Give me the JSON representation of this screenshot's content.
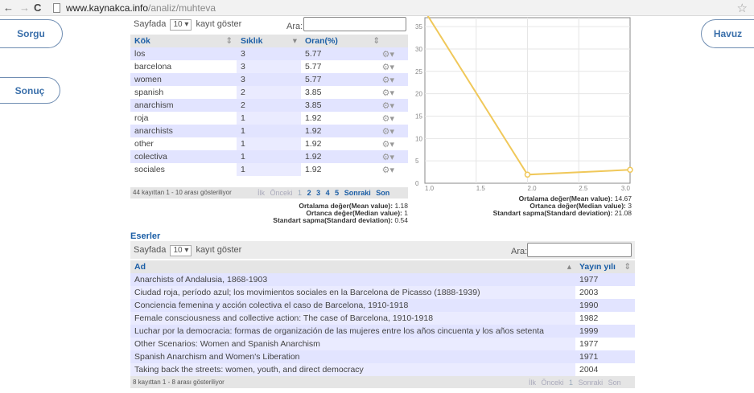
{
  "browser": {
    "back": "←",
    "forward": "→",
    "reload": "C",
    "url_host": "www.kaynakca.info",
    "url_path": "/analiz/muhteva",
    "star": "☆"
  },
  "side_tabs": {
    "sorgu": "Sorgu",
    "sonuc": "Sonuç",
    "havuz": "Havuz"
  },
  "top_table": {
    "length_prefix": "Sayfada",
    "length_value": "10",
    "length_suffix": "kayıt göster",
    "search_label": "Ara:",
    "headers": [
      "Kök",
      "Sıklık",
      "Oran(%)"
    ],
    "rows": [
      [
        "los",
        "3",
        "5.77"
      ],
      [
        "barcelona",
        "3",
        "5.77"
      ],
      [
        "women",
        "3",
        "5.77"
      ],
      [
        "spanish",
        "2",
        "3.85"
      ],
      [
        "anarchism",
        "2",
        "3.85"
      ],
      [
        "roja",
        "1",
        "1.92"
      ],
      [
        "anarchists",
        "1",
        "1.92"
      ],
      [
        "other",
        "1",
        "1.92"
      ],
      [
        "colectiva",
        "1",
        "1.92"
      ],
      [
        "sociales",
        "1",
        "1.92"
      ]
    ],
    "info": "44 kayıttan 1 - 10 arası gösteriliyor",
    "pager": {
      "first": "İlk",
      "prev": "Önceki",
      "pages": [
        "1",
        "2",
        "3",
        "4",
        "5"
      ],
      "next": "Sonraki",
      "last": "Son"
    },
    "stats": [
      {
        "k": "Ortalama değer(Mean value):",
        "v": "1.18"
      },
      {
        "k": "Ortanca değer(Median value):",
        "v": "1"
      },
      {
        "k": "Standart sapma(Standard deviation):",
        "v": "0.54"
      }
    ]
  },
  "chart_data": {
    "type": "line",
    "x": [
      1.0,
      2.0,
      3.0
    ],
    "y": [
      38.46,
      1.92,
      3.0
    ],
    "xlim": [
      1.0,
      3.0
    ],
    "ylim": [
      0,
      37
    ],
    "x_ticks": [
      "1.0",
      "1.5",
      "2.0",
      "2.5",
      "3.0"
    ],
    "y_ticks": [
      "0",
      "5",
      "10",
      "15",
      "20",
      "25",
      "30",
      "35"
    ],
    "line_color": "#f0c85a",
    "grid": true,
    "stats": [
      {
        "k": "Ortalama değer(Mean value):",
        "v": "14.67"
      },
      {
        "k": "Ortanca değer(Median value):",
        "v": "3"
      },
      {
        "k": "Standart sapma(Standard deviation):",
        "v": "21.08"
      }
    ]
  },
  "eserler": {
    "title": "Eserler",
    "length_prefix": "Sayfada",
    "length_value": "10",
    "length_suffix": "kayıt göster",
    "search_label": "Ara:",
    "headers": [
      "Ad",
      "Yayın yılı"
    ],
    "rows": [
      [
        "Anarchists of Andalusia, 1868-1903",
        "1977"
      ],
      [
        "Ciudad roja, período azul; los movimientos sociales en la Barcelona de Picasso (1888-1939)",
        "2003"
      ],
      [
        "Conciencia femenina y acción colectiva el caso de Barcelona, 1910-1918",
        "1990"
      ],
      [
        "Female consciousness and collective action: The case of Barcelona, 1910-1918",
        "1982"
      ],
      [
        "Luchar por la democracia: formas de organización de las mujeres entre los años cincuenta y los años setenta",
        "1999"
      ],
      [
        "Other Scenarios: Women and Spanish Anarchism",
        "1977"
      ],
      [
        "Spanish Anarchism and Women's Liberation",
        "1971"
      ],
      [
        "Taking back the streets: women, youth, and direct democracy",
        "2004"
      ]
    ],
    "info": "8 kayıttan 1 - 8 arası gösteriliyor",
    "pager": {
      "first": "İlk",
      "prev": "Önceki",
      "page": "1",
      "next": "Sonraki",
      "last": "Son"
    }
  }
}
